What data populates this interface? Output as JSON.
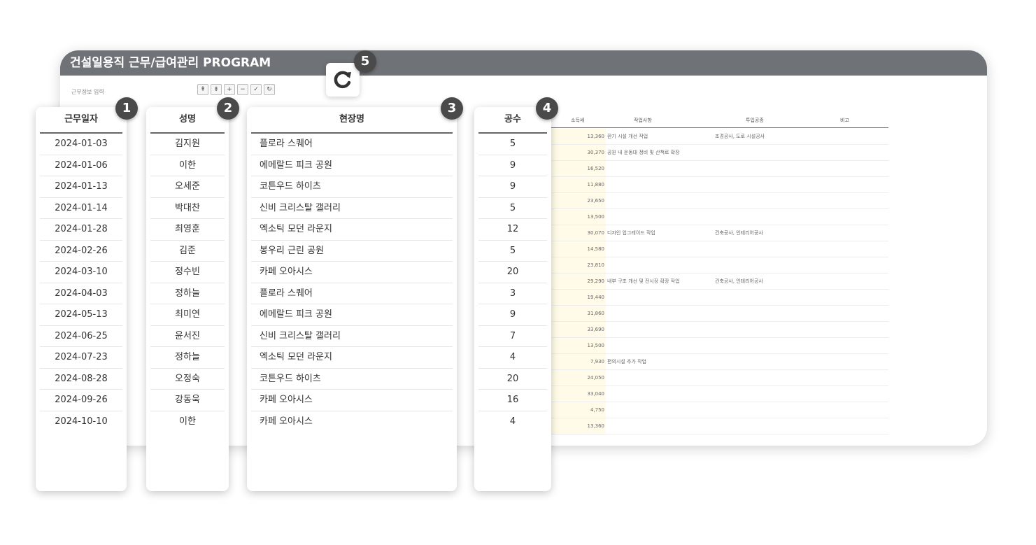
{
  "window": {
    "title": "건설일용직 근무/급여관리 PROGRAM",
    "toolbar_label": "근무정보 입력",
    "toolbar_buttons": [
      "⇞",
      "⇟",
      "+",
      "−",
      "✓",
      "↻"
    ]
  },
  "background_table": {
    "headers": {
      "tax": "소득세",
      "work": "작업사항",
      "type": "투입공종",
      "note": "비고"
    },
    "tax_values": [
      "13,360",
      "30,370",
      "16,520",
      "11,880",
      "23,650",
      "13,500",
      "30,070",
      "14,580",
      "23,810",
      "29,290",
      "19,440",
      "31,860",
      "33,690",
      "13,500",
      "7,930",
      "24,050",
      "33,040",
      "4,750",
      "13,360"
    ],
    "work_notes": [
      {
        "row": 0,
        "work": "환기 시설 개선 작업",
        "type": "조경공사, 도로 시설공사"
      },
      {
        "row": 1,
        "work": "공원 내 운동대 정비 및 산책로 확장",
        "type": ""
      },
      {
        "row": 6,
        "work": "디자인 업그레이드 작업",
        "type": "건축공사, 인테리어공사"
      },
      {
        "row": 9,
        "work": "내부 구조 개선 및 전시장 확장 작업",
        "type": "건축공사, 인테리어공사"
      },
      {
        "row": 14,
        "work": "편의시설 추가 작업",
        "type": ""
      }
    ]
  },
  "cards": {
    "date": {
      "header": "근무일자",
      "badge": "1",
      "values": [
        "2024-01-03",
        "2024-01-06",
        "2024-01-13",
        "2024-01-14",
        "2024-01-28",
        "2024-02-26",
        "2024-03-10",
        "2024-04-03",
        "2024-05-13",
        "2024-06-25",
        "2024-07-23",
        "2024-08-28",
        "2024-09-26",
        "2024-10-10"
      ]
    },
    "name": {
      "header": "성명",
      "badge": "2",
      "values": [
        "김지원",
        "이한",
        "오세준",
        "박대찬",
        "최영훈",
        "김준",
        "정수빈",
        "정하늘",
        "최미연",
        "윤서진",
        "정하늘",
        "오정숙",
        "강동욱",
        "이한"
      ]
    },
    "site": {
      "header": "현장명",
      "badge": "3",
      "values": [
        "플로라 스퀘어",
        "에메랄드 피크 공원",
        "코튼우드 하이츠",
        "신비 크리스탈 갤러리",
        "엑소틱 모던 라운지",
        "봉우리 근린 공원",
        "카페 오아시스",
        "플로라 스퀘어",
        "에메랄드 피크 공원",
        "신비 크리스탈 갤러리",
        "엑소틱 모던 라운지",
        "코튼우드 하이츠",
        "카페 오아시스",
        "카페 오아시스"
      ]
    },
    "workdays": {
      "header": "공수",
      "badge": "4",
      "values": [
        "5",
        "9",
        "9",
        "5",
        "12",
        "5",
        "20",
        "3",
        "9",
        "7",
        "4",
        "20",
        "16",
        "4"
      ]
    }
  },
  "refresh": {
    "badge": "5"
  }
}
